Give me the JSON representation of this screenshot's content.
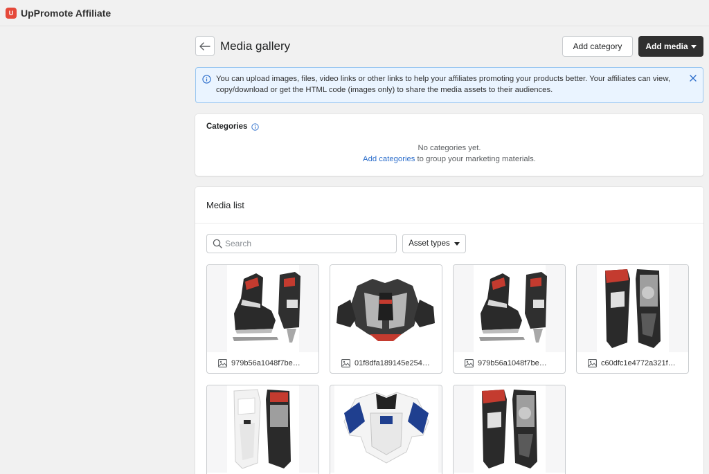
{
  "app": {
    "title": "UpPromote Affiliate",
    "logo_icon": "uppromote-logo-icon",
    "accent": "#e5493a"
  },
  "header": {
    "title": "Media gallery",
    "add_category_label": "Add category",
    "add_media_label": "Add media"
  },
  "banner": {
    "text": "You can upload images, files, video links or other links to help your affiliates promoting your products better. Your affiliates can view, copy/download or get the HTML code (images only) to share the media assets to their audiences."
  },
  "categories": {
    "title": "Categories",
    "empty_text": "No categories yet.",
    "add_link": "Add categories",
    "add_suffix": " to group your marketing materials."
  },
  "media_list": {
    "title": "Media list",
    "search_placeholder": "Search",
    "asset_types_label": "Asset types",
    "items": [
      {
        "name": "979b56a1048f7be…",
        "image": "skates"
      },
      {
        "name": "01f8dfa189145e254…",
        "image": "chest-protector"
      },
      {
        "name": "979b56a1048f7be…",
        "image": "skates"
      },
      {
        "name": "c60dfc1e4772a321f…",
        "image": "shin-guards"
      },
      {
        "name": "",
        "image": "shin-guards-white"
      },
      {
        "name": "",
        "image": "shoulder-pads"
      },
      {
        "name": "",
        "image": "shin-guards"
      }
    ]
  }
}
